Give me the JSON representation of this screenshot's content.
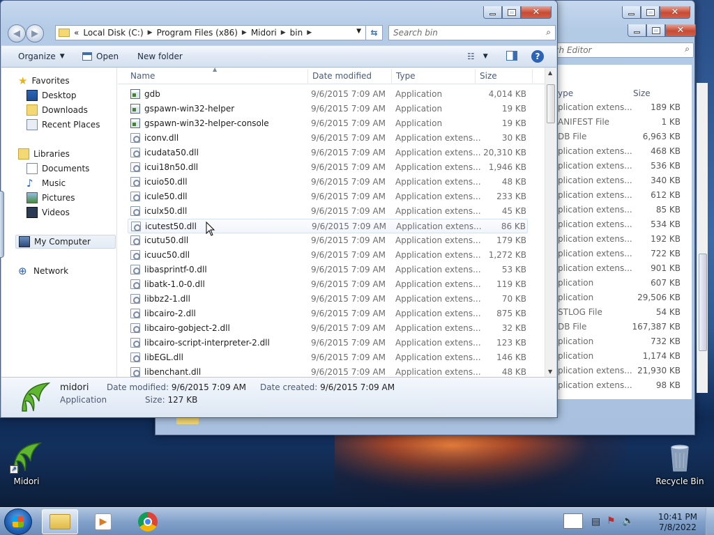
{
  "desktop": {
    "icons": [
      {
        "label": "Midori"
      },
      {
        "label": "Recycle Bin"
      }
    ]
  },
  "back_window": {
    "search_placeholder": "rch Editor",
    "column_headers": [
      "ype",
      "Size"
    ],
    "rows": [
      {
        "type": "plication extens...",
        "size": "189 KB"
      },
      {
        "type": "ANIFEST File",
        "size": "1 KB"
      },
      {
        "type": "DB File",
        "size": "6,963 KB"
      },
      {
        "type": "plication extens...",
        "size": "468 KB"
      },
      {
        "type": "plication extens...",
        "size": "536 KB"
      },
      {
        "type": "plication extens...",
        "size": "340 KB"
      },
      {
        "type": "plication extens...",
        "size": "612 KB"
      },
      {
        "type": "plication extens...",
        "size": "85 KB"
      },
      {
        "type": "plication extens...",
        "size": "534 KB"
      },
      {
        "type": "plication extens...",
        "size": "192 KB"
      },
      {
        "type": "plication extens...",
        "size": "722 KB"
      },
      {
        "type": "plication extens...",
        "size": "901 KB"
      },
      {
        "type": "plication",
        "size": "607 KB"
      },
      {
        "type": "plication",
        "size": "29,506 KB"
      },
      {
        "type": "STLOG File",
        "size": "54 KB"
      },
      {
        "type": "DB File",
        "size": "167,387 KB"
      },
      {
        "type": "plication",
        "size": "732 KB"
      },
      {
        "type": "plication",
        "size": "1,174 KB"
      },
      {
        "type": "plication extens...",
        "size": "21,930 KB"
      },
      {
        "type": "plication extens...",
        "size": "98 KB"
      }
    ]
  },
  "address": {
    "prefix": "«",
    "crumbs": [
      "Local Disk (C:)",
      "Program Files (x86)",
      "Midori",
      "bin"
    ],
    "search_placeholder": "Search bin"
  },
  "toolbar": {
    "organize_label": "Organize",
    "open_label": "Open",
    "new_folder_label": "New folder"
  },
  "nav": {
    "favorites": {
      "label": "Favorites",
      "items": [
        "Desktop",
        "Downloads",
        "Recent Places"
      ]
    },
    "libraries": {
      "label": "Libraries",
      "items": [
        "Documents",
        "Music",
        "Pictures",
        "Videos"
      ]
    },
    "computer": {
      "label": "My Computer"
    },
    "network": {
      "label": "Network"
    }
  },
  "columns": {
    "name": "Name",
    "date": "Date modified",
    "type": "Type",
    "size": "Size"
  },
  "files": [
    {
      "name": "gdb",
      "date": "9/6/2015 7:09 AM",
      "type": "Application",
      "size": "4,014 KB",
      "kind": "app"
    },
    {
      "name": "gspawn-win32-helper",
      "date": "9/6/2015 7:09 AM",
      "type": "Application",
      "size": "19 KB",
      "kind": "app"
    },
    {
      "name": "gspawn-win32-helper-console",
      "date": "9/6/2015 7:09 AM",
      "type": "Application",
      "size": "19 KB",
      "kind": "app"
    },
    {
      "name": "iconv.dll",
      "date": "9/6/2015 7:09 AM",
      "type": "Application extens...",
      "size": "30 KB",
      "kind": "dll"
    },
    {
      "name": "icudata50.dll",
      "date": "9/6/2015 7:09 AM",
      "type": "Application extens...",
      "size": "20,310 KB",
      "kind": "dll"
    },
    {
      "name": "icui18n50.dll",
      "date": "9/6/2015 7:09 AM",
      "type": "Application extens...",
      "size": "1,946 KB",
      "kind": "dll"
    },
    {
      "name": "icuio50.dll",
      "date": "9/6/2015 7:09 AM",
      "type": "Application extens...",
      "size": "48 KB",
      "kind": "dll"
    },
    {
      "name": "icule50.dll",
      "date": "9/6/2015 7:09 AM",
      "type": "Application extens...",
      "size": "233 KB",
      "kind": "dll"
    },
    {
      "name": "iculx50.dll",
      "date": "9/6/2015 7:09 AM",
      "type": "Application extens...",
      "size": "45 KB",
      "kind": "dll"
    },
    {
      "name": "icutest50.dll",
      "date": "9/6/2015 7:09 AM",
      "type": "Application extens...",
      "size": "86 KB",
      "kind": "dll"
    },
    {
      "name": "icutu50.dll",
      "date": "9/6/2015 7:09 AM",
      "type": "Application extens...",
      "size": "179 KB",
      "kind": "dll"
    },
    {
      "name": "icuuc50.dll",
      "date": "9/6/2015 7:09 AM",
      "type": "Application extens...",
      "size": "1,272 KB",
      "kind": "dll"
    },
    {
      "name": "libasprintf-0.dll",
      "date": "9/6/2015 7:09 AM",
      "type": "Application extens...",
      "size": "53 KB",
      "kind": "dll"
    },
    {
      "name": "libatk-1.0-0.dll",
      "date": "9/6/2015 7:09 AM",
      "type": "Application extens...",
      "size": "119 KB",
      "kind": "dll"
    },
    {
      "name": "libbz2-1.dll",
      "date": "9/6/2015 7:09 AM",
      "type": "Application extens...",
      "size": "70 KB",
      "kind": "dll"
    },
    {
      "name": "libcairo-2.dll",
      "date": "9/6/2015 7:09 AM",
      "type": "Application extens...",
      "size": "875 KB",
      "kind": "dll"
    },
    {
      "name": "libcairo-gobject-2.dll",
      "date": "9/6/2015 7:09 AM",
      "type": "Application extens...",
      "size": "32 KB",
      "kind": "dll"
    },
    {
      "name": "libcairo-script-interpreter-2.dll",
      "date": "9/6/2015 7:09 AM",
      "type": "Application extens...",
      "size": "123 KB",
      "kind": "dll"
    },
    {
      "name": "libEGL.dll",
      "date": "9/6/2015 7:09 AM",
      "type": "Application extens...",
      "size": "146 KB",
      "kind": "dll"
    },
    {
      "name": "libenchant.dll",
      "date": "9/6/2015 7:09 AM",
      "type": "Application extens...",
      "size": "48 KB",
      "kind": "dll"
    }
  ],
  "hovered_file": "icutest50.dll",
  "details": {
    "name": "midori",
    "kind": "Application",
    "modified_label": "Date modified:",
    "modified_value": "9/6/2015 7:09 AM",
    "created_label": "Date created:",
    "created_value": "9/6/2015 7:09 AM",
    "size_label": "Size:",
    "size_value": "127 KB"
  },
  "clock": {
    "time": "10:41 PM",
    "date": "7/8/2022"
  },
  "colors": {
    "accent": "#3a6db5",
    "selection": "#d6e2f2",
    "close_button": "#c64b34"
  }
}
